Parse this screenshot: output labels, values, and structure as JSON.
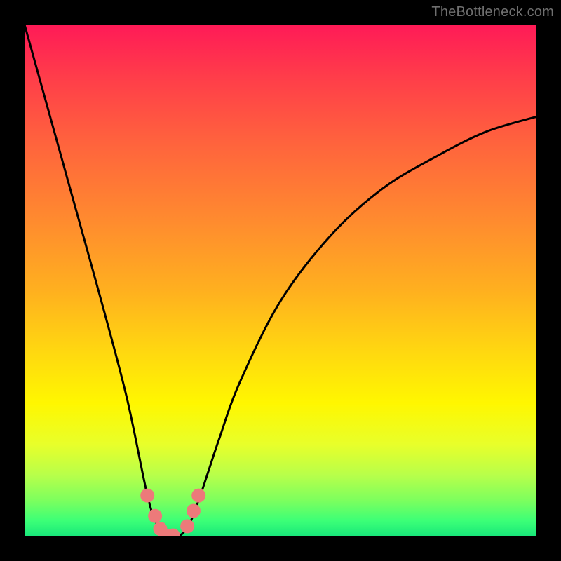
{
  "watermark": "TheBottleneck.com",
  "chart_data": {
    "type": "line",
    "title": "",
    "xlabel": "",
    "ylabel": "",
    "xlim": [
      0,
      100
    ],
    "ylim": [
      0,
      100
    ],
    "series": [
      {
        "name": "bottleneck-curve",
        "x": [
          0,
          5,
          10,
          15,
          20,
          24,
          26,
          27,
          28,
          30,
          32,
          34,
          36,
          38,
          42,
          50,
          60,
          70,
          80,
          90,
          100
        ],
        "y": [
          100,
          82,
          64,
          46,
          27,
          8,
          2,
          0,
          0,
          0,
          2,
          7,
          13,
          19,
          30,
          46,
          59,
          68,
          74,
          79,
          82
        ]
      }
    ],
    "markers": [
      {
        "name": "marker-left-1",
        "x": 24.0,
        "y": 8.0
      },
      {
        "name": "marker-left-2",
        "x": 25.5,
        "y": 4.0
      },
      {
        "name": "marker-left-3",
        "x": 26.5,
        "y": 1.5
      },
      {
        "name": "marker-bottom-1",
        "x": 27.5,
        "y": 0.2
      },
      {
        "name": "marker-bottom-2",
        "x": 29.0,
        "y": 0.2
      },
      {
        "name": "marker-right-1",
        "x": 31.8,
        "y": 2.0
      },
      {
        "name": "marker-right-2",
        "x": 33.0,
        "y": 5.0
      },
      {
        "name": "marker-right-3",
        "x": 34.0,
        "y": 8.0
      }
    ],
    "marker_color": "#ec7a7a",
    "curve_color": "#000000"
  }
}
